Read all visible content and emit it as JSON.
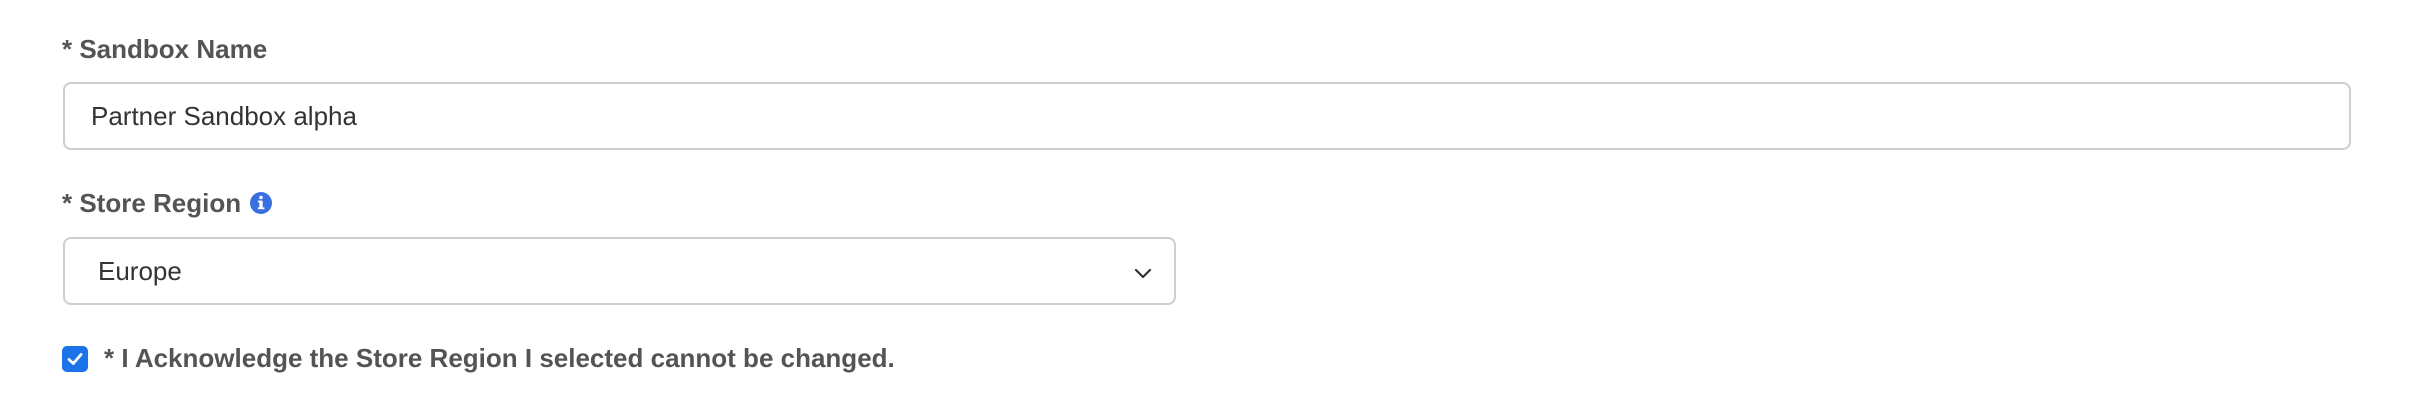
{
  "sandbox_name": {
    "label": "* Sandbox Name",
    "value": "Partner Sandbox alpha"
  },
  "store_region": {
    "label": "* Store Region",
    "info_icon": "info-icon",
    "selected": "Europe",
    "dropdown_icon": "chevron-down-icon"
  },
  "acknowledge": {
    "checked": true,
    "label": "* I Acknowledge the Store Region I selected cannot be changed."
  },
  "colors": {
    "accent": "#1a73e8",
    "label_text": "#545454",
    "border": "#cfcfcf"
  }
}
